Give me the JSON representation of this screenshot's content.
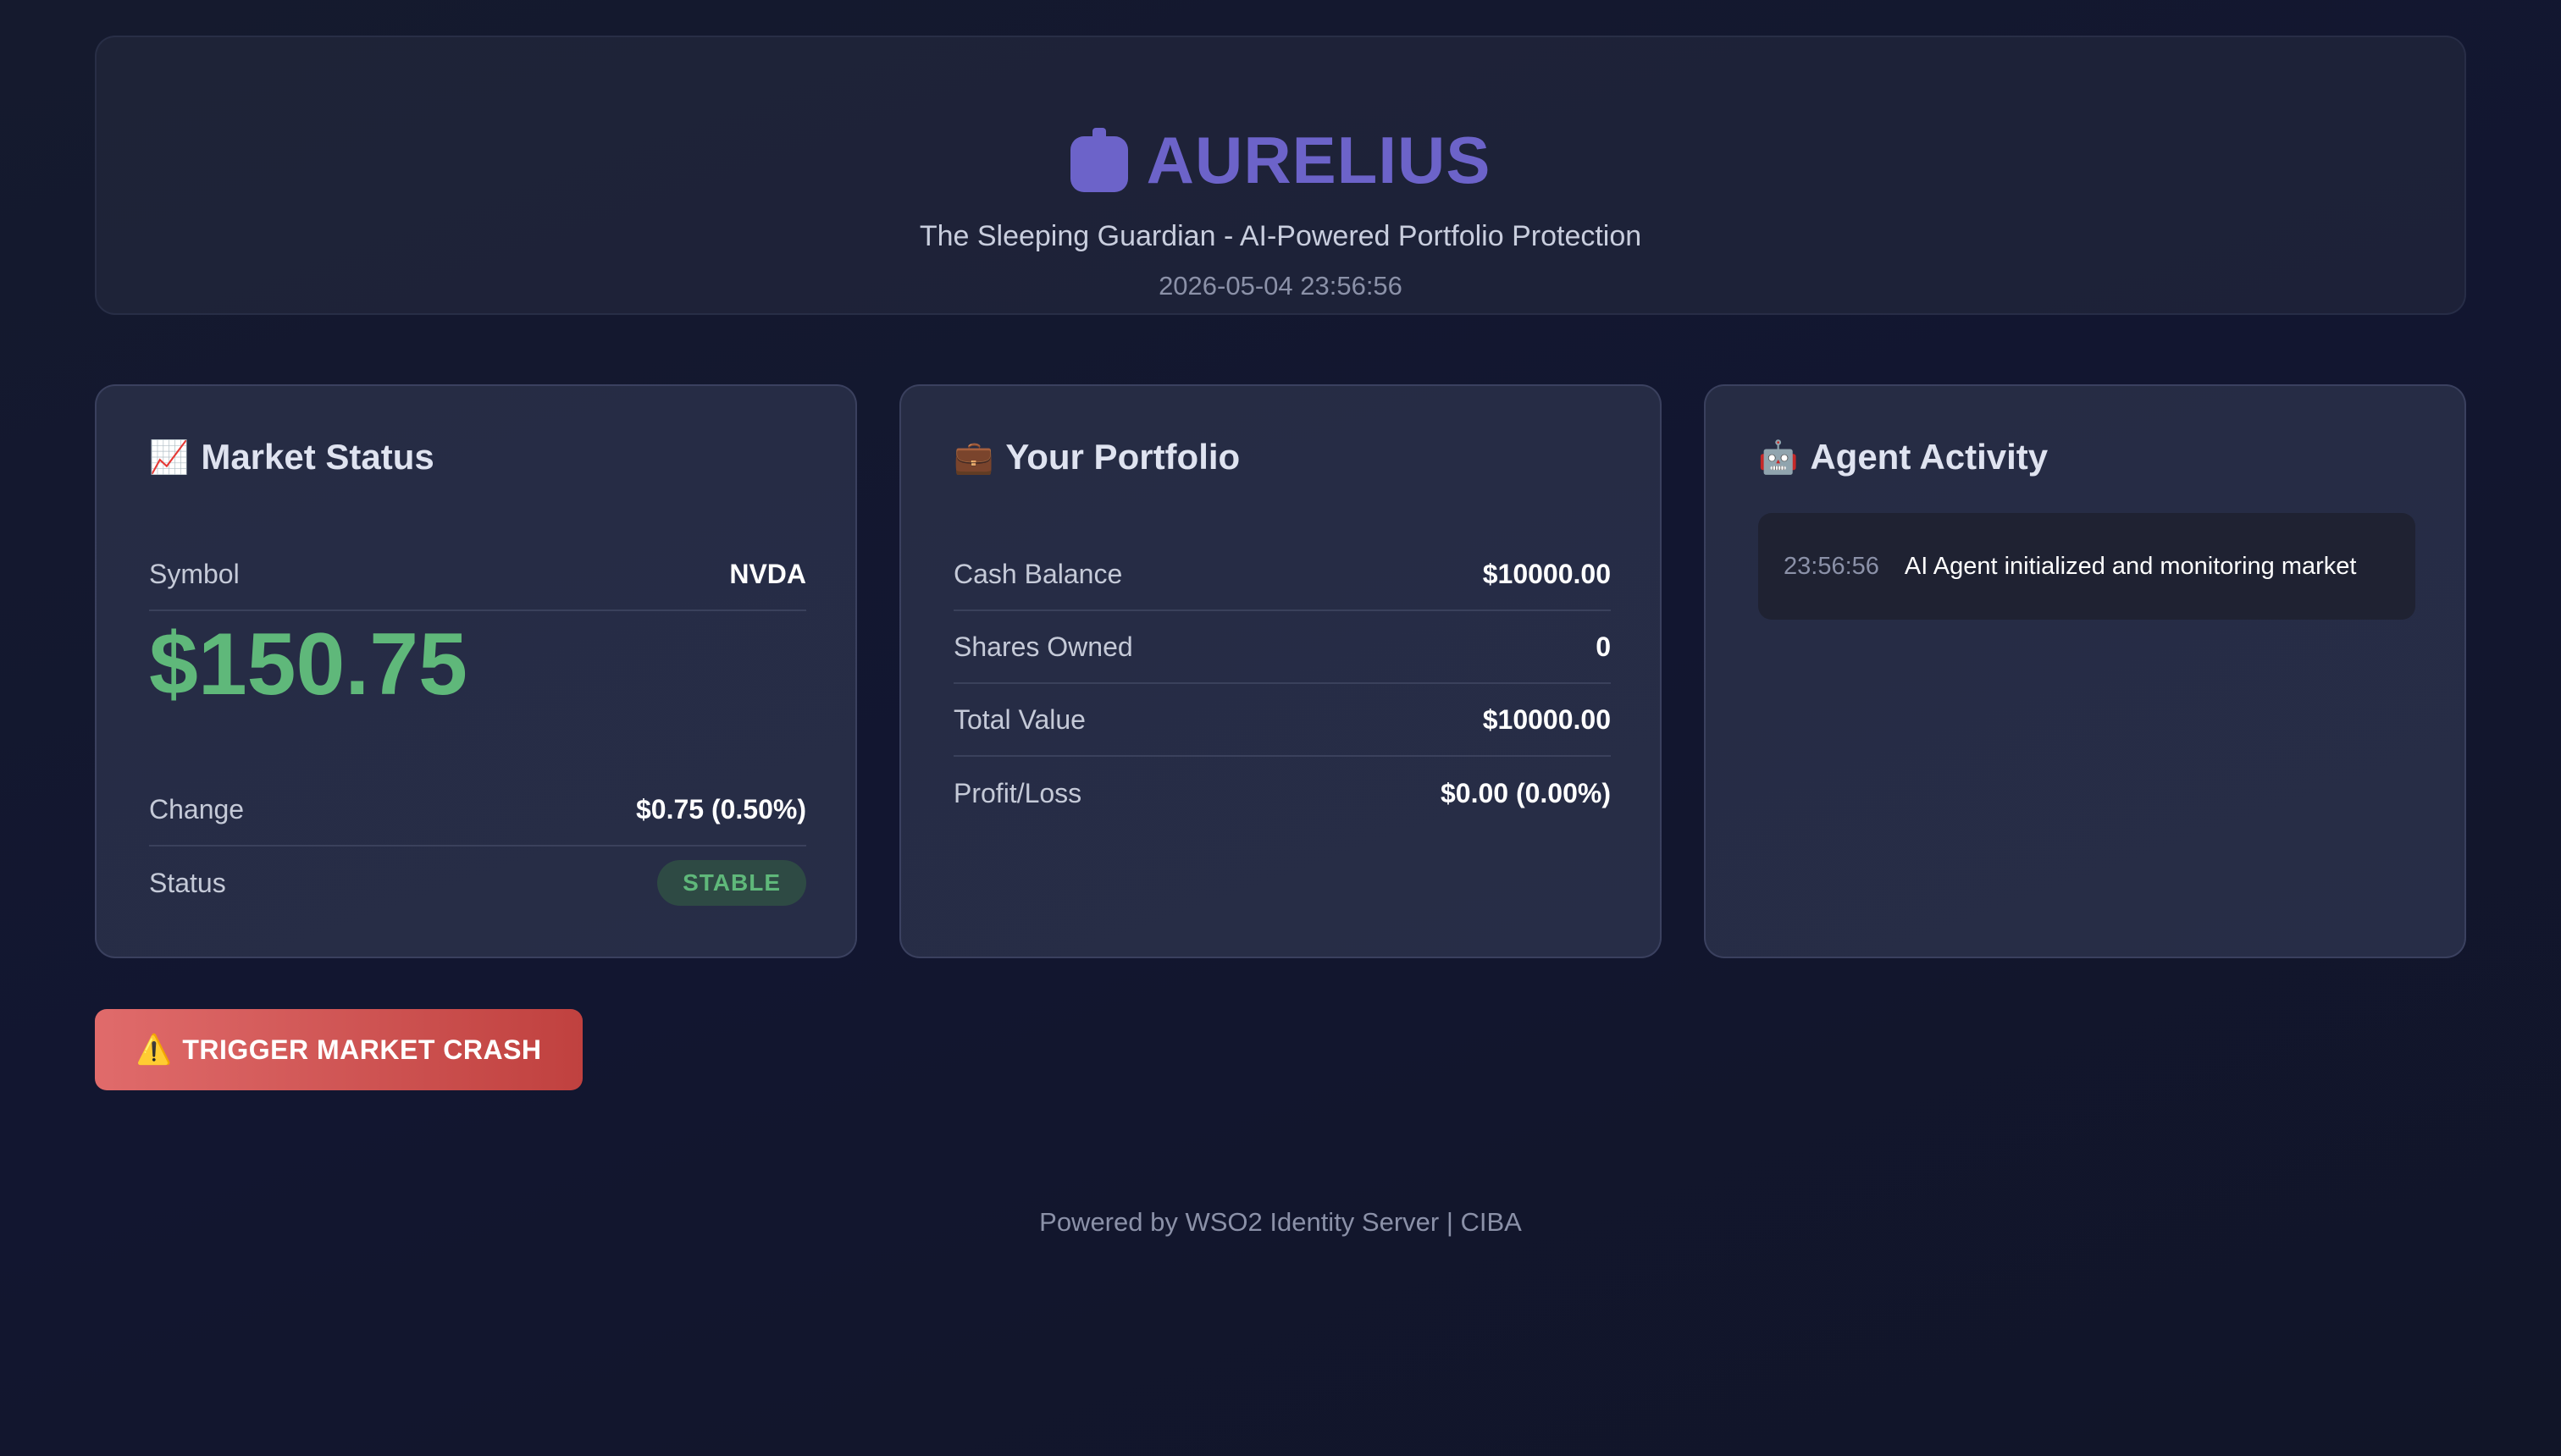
{
  "header": {
    "brand_icon": "robot-icon",
    "title": "AURELIUS",
    "subtitle": "The Sleeping Guardian - AI-Powered Portfolio Protection",
    "timestamp": "2026-05-04 23:56:56"
  },
  "market": {
    "icon": "📈",
    "title": "Market Status",
    "symbol_label": "Symbol",
    "symbol_value": "NVDA",
    "price": "$150.75",
    "change_label": "Change",
    "change_value": "$0.75 (0.50%)",
    "status_label": "Status",
    "status_value": "STABLE"
  },
  "portfolio": {
    "icon": "💼",
    "title": "Your Portfolio",
    "rows": [
      {
        "label": "Cash Balance",
        "value": "$10000.00"
      },
      {
        "label": "Shares Owned",
        "value": "0"
      },
      {
        "label": "Total Value",
        "value": "$10000.00"
      },
      {
        "label": "Profit/Loss",
        "value": "$0.00 (0.00%)"
      }
    ]
  },
  "agent": {
    "icon": "🤖",
    "title": "Agent Activity",
    "entries": [
      {
        "time": "23:56:56",
        "message": "AI Agent initialized and monitoring market"
      }
    ]
  },
  "actions": {
    "crash_icon": "⚠️",
    "crash_label": "TRIGGER MARKET CRASH"
  },
  "footer": {
    "text": "Powered by WSO2 Identity Server | CIBA"
  },
  "colors": {
    "brand": "#6c63c9",
    "positive": "#5fb87a",
    "danger": "#e06b6b",
    "background": "#131730"
  }
}
